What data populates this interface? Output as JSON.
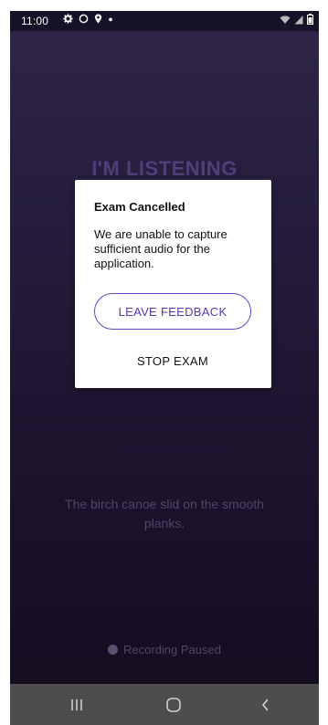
{
  "status_bar": {
    "time": "11:00",
    "icons_left": [
      "settings-icon",
      "circle-icon",
      "location-icon",
      "dot-icon"
    ],
    "icons_right": [
      "wifi-icon",
      "signal-icon",
      "battery-icon"
    ]
  },
  "screen": {
    "title": "I'M LISTENING",
    "prompt_sentence": "The birch canoe slid on the smooth planks.",
    "recording_status": "Recording Paused"
  },
  "dialog": {
    "title": "Exam Cancelled",
    "message": "We are unable to capture sufficient audio for the application.",
    "primary_button": "LEAVE FEEDBACK",
    "secondary_button": "STOP EXAM"
  },
  "nav_bar": {
    "buttons": [
      "recents-icon",
      "home-icon",
      "back-icon"
    ]
  },
  "colors": {
    "accent": "#6a42c7",
    "background_top": "#2e2547",
    "background_bottom": "#150d20",
    "nav_bar": "#4d4d4d"
  }
}
